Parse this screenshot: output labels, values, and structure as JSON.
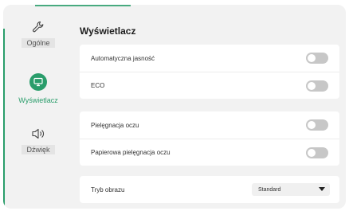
{
  "colors": {
    "accent": "#2a9d6b",
    "panel_bg": "#f2f2f2",
    "card_bg": "#ffffff",
    "toggle_off": "#c7c7c7"
  },
  "sidebar": {
    "items": [
      {
        "label": "Ogólne",
        "icon": "wrench-icon",
        "active": false
      },
      {
        "label": "Wyświetlacz",
        "icon": "monitor-icon",
        "active": true
      },
      {
        "label": "Dźwięk",
        "icon": "speaker-icon",
        "active": false
      }
    ]
  },
  "main": {
    "title": "Wyświetlacz",
    "groups": [
      {
        "rows": [
          {
            "label": "Automatyczna jasność",
            "control": "toggle",
            "state": "off"
          },
          {
            "label": "ECO",
            "control": "toggle",
            "state": "off"
          }
        ]
      },
      {
        "rows": [
          {
            "label": "Pielęgnacja oczu",
            "control": "toggle",
            "state": "off"
          },
          {
            "label": "Papierowa pielęgnacja oczu",
            "control": "toggle",
            "state": "off"
          }
        ]
      },
      {
        "rows": [
          {
            "label": "Tryb obrazu",
            "control": "select",
            "value": "Standard"
          }
        ]
      }
    ]
  }
}
